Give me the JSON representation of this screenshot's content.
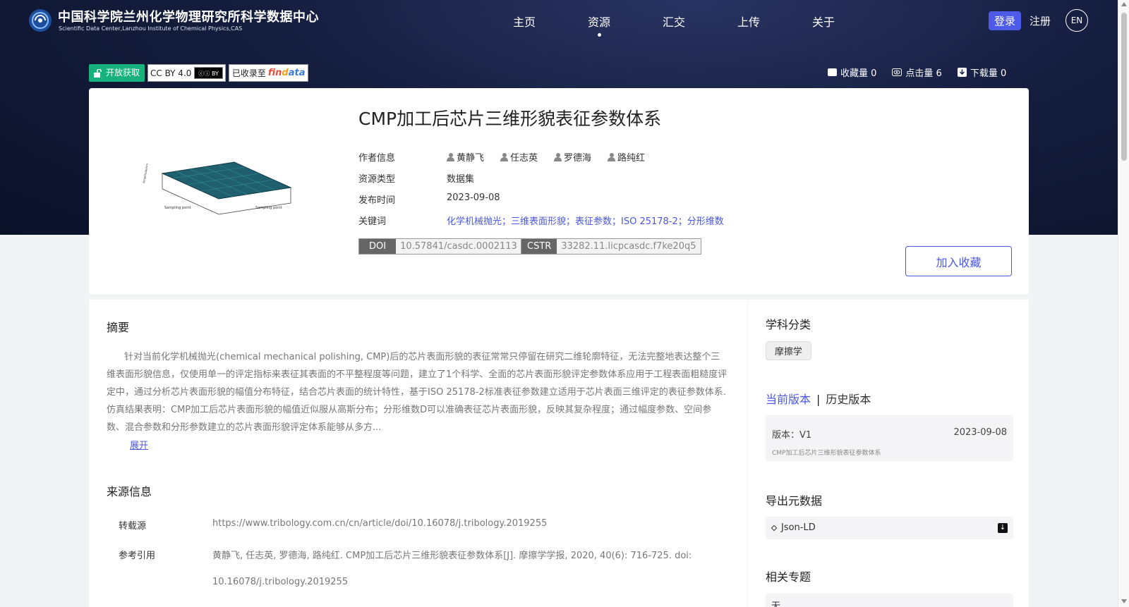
{
  "header": {
    "title": "中国科学院兰州化学物理研究所科学数据中心",
    "subtitle": "Scientific Data Center,Lanzhou Institute of Chemical Physics,CAS",
    "nav": [
      "主页",
      "资源",
      "汇交",
      "上传",
      "关于"
    ],
    "active_nav": "资源",
    "login": "登录",
    "register": "注册",
    "lang": "EN"
  },
  "badges": {
    "open_access": "开放获取",
    "license": "CC BY 4.0",
    "indexed_in": "已收录至",
    "findata_logo": "findata"
  },
  "stats": {
    "favorites": "收藏量 0",
    "clicks": "点击量 6",
    "downloads": "下载量 0"
  },
  "resource": {
    "title": "CMP加工后芯片三维形貌表征参数体系",
    "author_label": "作者信息",
    "authors": [
      "黄静飞",
      "任志英",
      "罗德海",
      "路纯红"
    ],
    "type_label": "资源类型",
    "type": "数据集",
    "date_label": "发布时间",
    "date": "2023-09-08",
    "keywords_label": "关键词",
    "keywords": "化学机械抛光；三维表面形貌；表征参数；ISO 25178-2；分形维数",
    "doi_label": "DOI",
    "doi": "10.57841/casdc.0002113",
    "cstr_label": "CSTR",
    "cstr": "33282.11.licpcasdc.f7ke20q5",
    "fav_button": "加入收藏"
  },
  "abstract": {
    "heading": "摘要",
    "text": "针对当前化学机械抛光(chemical mechanical polishing, CMP)后的芯片表面形貌的表征常常只停留在研究二维轮廓特征，无法完整地表达整个三维表面形貌信息，仅使用单一的评定指标来表征其表面的不平整程度等问题，建立了1个科学、全面的芯片表面形貌评定参数体系应用于工程表面粗糙度评定中，通过分析芯片表面形貌的幅值分布特征，结合芯片表面的统计特性，基于ISO 25178-2标准表征参数建立适用于芯片表面三维评定的表征参数体系. 仿真结果表明：CMP加工后芯片表面形貌的幅值近似服从高斯分布；分形维数D可以准确表征芯片表面形貌，反映其复杂程度；通过幅度参数、空间参数、混合参数和分形参数建立的芯片表面形貌评定体系能够从多方...",
    "expand": "展开"
  },
  "source": {
    "heading": "来源信息",
    "repost_label": "转载源",
    "repost": "https://www.tribology.com.cn/cn/article/doi/10.16078/j.tribology.2019255",
    "cite_label": "参考引用",
    "cite_line1": "黄静飞, 任志英, 罗德海, 路纯红. CMP加工后芯片三维形貌表征参数体系[J]. 摩擦学学报, 2020, 40(6): 716-725. doi:",
    "cite_line2": "10.16078/j.tribology.2019255"
  },
  "sidebar": {
    "subject_heading": "学科分类",
    "subject_tag": "摩擦学",
    "current_version": "当前版本",
    "version_sep": "|",
    "history_version": "历史版本",
    "version_name": "版本：V1",
    "version_date": "2023-09-08",
    "version_desc": "CMP加工后芯片三维形貌表征参数体系",
    "export_heading": "导出元数据",
    "export_format": "Json-LD",
    "topics_heading": "相关专题",
    "topics_value": "无"
  },
  "thumbnail": {
    "x_label": "Sampling point",
    "y_label": "Sampling point",
    "z_label": "Amplitude/nm"
  }
}
